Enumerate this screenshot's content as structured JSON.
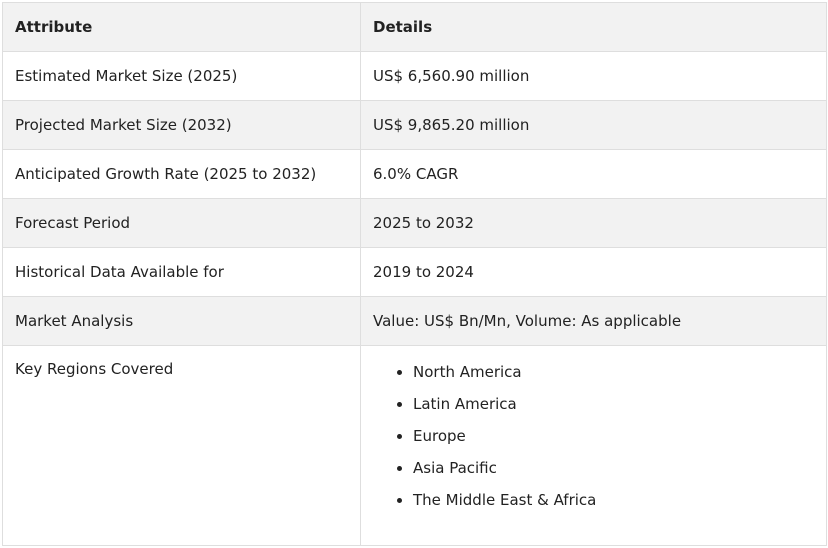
{
  "table": {
    "header": {
      "attribute": "Attribute",
      "details": "Details"
    },
    "rows": [
      {
        "attribute": "Estimated Market Size (2025)",
        "details": "US$ 6,560.90 million"
      },
      {
        "attribute": "Projected Market Size (2032)",
        "details": "US$ 9,865.20 million"
      },
      {
        "attribute": "Anticipated Growth Rate (2025 to 2032)",
        "details": "6.0% CAGR"
      },
      {
        "attribute": "Forecast Period",
        "details": "2025 to 2032"
      },
      {
        "attribute": "Historical Data Available for",
        "details": "2019 to 2024"
      },
      {
        "attribute": "Market Analysis",
        "details": "Value: US$ Bn/Mn, Volume: As applicable"
      }
    ],
    "regions": {
      "attribute": "Key Regions Covered",
      "items": [
        "North America",
        "Latin America",
        "Europe",
        "Asia Pacific",
        "The Middle East & Africa"
      ]
    }
  },
  "colors": {
    "stripe": "#f2f2f2",
    "border": "#dedede",
    "text": "#222222"
  }
}
